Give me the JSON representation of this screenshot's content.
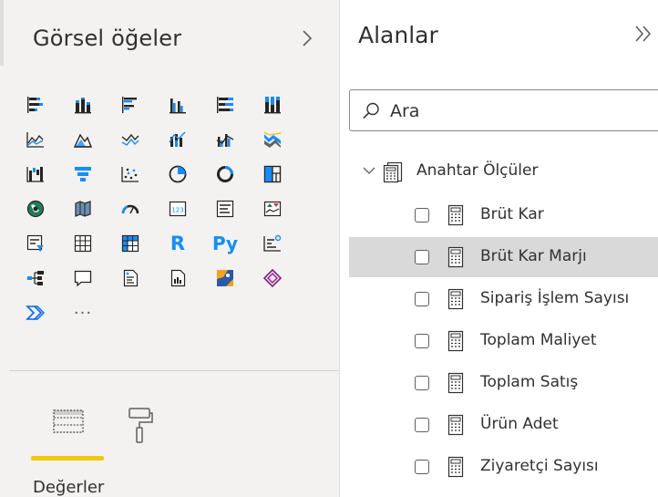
{
  "visualizations": {
    "title": "Görsel öğeler",
    "collapse_icon": "chevron-right-icon",
    "icon_rows": [
      [
        "stacked-bar-chart-icon",
        "stacked-column-chart-icon",
        "clustered-bar-chart-icon",
        "clustered-column-chart-icon",
        "100-stacked-bar-chart-icon",
        "100-stacked-column-chart-icon"
      ],
      [
        "line-chart-icon",
        "area-chart-icon",
        "stacked-area-chart-icon",
        "line-and-stacked-column-icon",
        "line-and-clustered-column-icon",
        "ribbon-chart-icon"
      ],
      [
        "waterfall-chart-icon",
        "funnel-icon",
        "scatter-chart-icon",
        "pie-chart-icon",
        "donut-chart-icon",
        "treemap-icon"
      ],
      [
        "map-icon",
        "filled-map-icon",
        "gauge-icon",
        "card-icon",
        "multi-row-card-icon",
        "kpi-icon"
      ],
      [
        "slicer-icon",
        "table-icon",
        "matrix-icon",
        "r-visual-icon",
        "python-visual-icon",
        "key-influencers-icon"
      ],
      [
        "decomposition-tree-icon",
        "qa-icon",
        "smart-narrative-icon",
        "paginated-report-icon",
        "arcgis-map-icon",
        "power-apps-icon"
      ],
      [
        "power-automate-icon",
        "more-visuals-icon"
      ]
    ],
    "r_text": "R",
    "py_text": "Py",
    "more_text": "···"
  },
  "build_tabs": [
    {
      "icon": "fields-well-icon",
      "active": true
    },
    {
      "icon": "format-paint-roller-icon",
      "active": false
    }
  ],
  "well": {
    "values_label": "Değerler"
  },
  "fields": {
    "title": "Alanlar",
    "expand_icon": "double-chevron-right-icon",
    "search": {
      "placeholder": "Ara"
    },
    "table": {
      "name": "Anahtar Ölçüler",
      "expanded": true,
      "icon": "measure-table-icon"
    },
    "items": [
      {
        "label": "Brüt Kar",
        "checked": false,
        "selected": false
      },
      {
        "label": "Brüt Kar Marjı",
        "checked": false,
        "selected": true
      },
      {
        "label": "Sipariş İşlem Sayısı",
        "checked": false,
        "selected": false
      },
      {
        "label": "Toplam Maliyet",
        "checked": false,
        "selected": false
      },
      {
        "label": "Toplam Satış",
        "checked": false,
        "selected": false
      },
      {
        "label": "Ürün Adet",
        "checked": false,
        "selected": false
      },
      {
        "label": "Ziyaretçi Sayısı",
        "checked": false,
        "selected": false
      }
    ]
  },
  "colors": {
    "accent_yellow": "#f2c811",
    "pane_bg": "#f3f2f1",
    "selected_row": "#d9d9d9",
    "icon_blue": "#118dff",
    "icon_dark": "#252423"
  }
}
